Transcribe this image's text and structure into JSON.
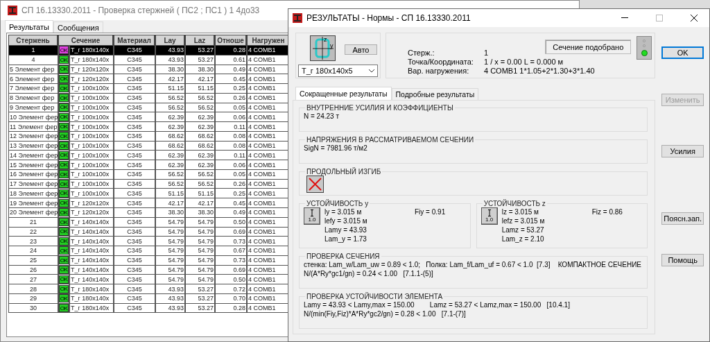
{
  "back_window": {
    "title": "СП 16.13330.2011 - Проверка стержней ( ПС2 ; ПС1 ) 1 4до33",
    "tabs": [
      {
        "label": "Результаты",
        "selected": true
      },
      {
        "label": "Сообщения",
        "selected": false
      }
    ],
    "table": {
      "columns": [
        "Стержень",
        "Сечение",
        "Материал",
        "Lay",
        "Laz",
        "Отноше",
        "Нагружен"
      ],
      "rows": [
        {
          "num": "1",
          "status": "OK",
          "section": "T_г 180x140x",
          "material": "C345",
          "lay": "43.93",
          "laz": "53.27",
          "ratio": "0.28",
          "load": "4 COMB1",
          "selected": true
        },
        {
          "num": "4",
          "status": "OK",
          "section": "T_г 180x140x",
          "material": "C345",
          "lay": "43.93",
          "laz": "53.27",
          "ratio": "0.61",
          "load": "4 COMB1",
          "selected": false
        },
        {
          "num": "5",
          "name": "Элемент фер",
          "status": "OK",
          "section": "T_г 120x120x",
          "material": "C345",
          "lay": "38.30",
          "laz": "38.30",
          "ratio": "0.49",
          "load": "4 COMB1",
          "selected": false
        },
        {
          "num": "6",
          "name": "Элемент фер",
          "status": "OK",
          "section": "T_г 120x120x",
          "material": "C345",
          "lay": "42.17",
          "laz": "42.17",
          "ratio": "0.45",
          "load": "4 COMB1",
          "selected": false
        },
        {
          "num": "7",
          "name": "Элемент фер",
          "status": "OK",
          "section": "T_г 100x100x",
          "material": "C345",
          "lay": "51.15",
          "laz": "51.15",
          "ratio": "0.25",
          "load": "4 COMB1",
          "selected": false
        },
        {
          "num": "8",
          "name": "Элемент фер",
          "status": "OK",
          "section": "T_г 100x100x",
          "material": "C345",
          "lay": "56.52",
          "laz": "56.52",
          "ratio": "0.26",
          "load": "4 COMB1",
          "selected": false
        },
        {
          "num": "9",
          "name": "Элемент фер",
          "status": "OK",
          "section": "T_г 100x100x",
          "material": "C345",
          "lay": "56.52",
          "laz": "56.52",
          "ratio": "0.05",
          "load": "4 COMB1",
          "selected": false
        },
        {
          "num": "10",
          "name": "Элемент фер",
          "status": "OK",
          "section": "T_г 100x100x",
          "material": "C345",
          "lay": "62.39",
          "laz": "62.39",
          "ratio": "0.06",
          "load": "4 COMB1",
          "selected": false
        },
        {
          "num": "11",
          "name": "Элемент фер",
          "status": "OK",
          "section": "T_г 100x100x",
          "material": "C345",
          "lay": "62.39",
          "laz": "62.39",
          "ratio": "0.11",
          "load": "4 COMB1",
          "selected": false
        },
        {
          "num": "12",
          "name": "Элемент фер",
          "status": "OK",
          "section": "T_г 100x100x",
          "material": "C345",
          "lay": "68.62",
          "laz": "68.62",
          "ratio": "0.08",
          "load": "4 COMB1",
          "selected": false
        },
        {
          "num": "13",
          "name": "Элемент фер",
          "status": "OK",
          "section": "T_г 100x100x",
          "material": "C345",
          "lay": "68.62",
          "laz": "68.62",
          "ratio": "0.08",
          "load": "4 COMB1",
          "selected": false
        },
        {
          "num": "14",
          "name": "Элемент фер",
          "status": "OK",
          "section": "T_г 100x100x",
          "material": "C345",
          "lay": "62.39",
          "laz": "62.39",
          "ratio": "0.11",
          "load": "4 COMB1",
          "selected": false
        },
        {
          "num": "15",
          "name": "Элемент фер",
          "status": "OK",
          "section": "T_г 100x100x",
          "material": "C345",
          "lay": "62.39",
          "laz": "62.39",
          "ratio": "0.06",
          "load": "4 COMB1",
          "selected": false
        },
        {
          "num": "16",
          "name": "Элемент фер",
          "status": "OK",
          "section": "T_г 100x100x",
          "material": "C345",
          "lay": "56.52",
          "laz": "56.52",
          "ratio": "0.05",
          "load": "4 COMB1",
          "selected": false
        },
        {
          "num": "17",
          "name": "Элемент фер",
          "status": "OK",
          "section": "T_г 100x100x",
          "material": "C345",
          "lay": "56.52",
          "laz": "56.52",
          "ratio": "0.26",
          "load": "4 COMB1",
          "selected": false
        },
        {
          "num": "18",
          "name": "Элемент фер",
          "status": "OK",
          "section": "T_г 100x100x",
          "material": "C345",
          "lay": "51.15",
          "laz": "51.15",
          "ratio": "0.25",
          "load": "4 COMB1",
          "selected": false
        },
        {
          "num": "19",
          "name": "Элемент фер",
          "status": "OK",
          "section": "T_г 120x120x",
          "material": "C345",
          "lay": "42.17",
          "laz": "42.17",
          "ratio": "0.45",
          "load": "4 COMB1",
          "selected": false
        },
        {
          "num": "20",
          "name": "Элемент фер",
          "status": "OK",
          "section": "T_г 120x120x",
          "material": "C345",
          "lay": "38.30",
          "laz": "38.30",
          "ratio": "0.49",
          "load": "4 COMB1",
          "selected": false
        },
        {
          "num": "21",
          "status": "OK",
          "section": "T_г 140x140x",
          "material": "C345",
          "lay": "54.79",
          "laz": "54.79",
          "ratio": "0.50",
          "load": "4 COMB1",
          "selected": false
        },
        {
          "num": "22",
          "status": "OK",
          "section": "T_г 140x140x",
          "material": "C345",
          "lay": "54.79",
          "laz": "54.79",
          "ratio": "0.69",
          "load": "4 COMB1",
          "selected": false
        },
        {
          "num": "23",
          "status": "OK",
          "section": "T_г 140x140x",
          "material": "C345",
          "lay": "54.79",
          "laz": "54.79",
          "ratio": "0.73",
          "load": "4 COMB1",
          "selected": false
        },
        {
          "num": "24",
          "status": "OK",
          "section": "T_г 140x140x",
          "material": "C345",
          "lay": "54.79",
          "laz": "54.79",
          "ratio": "0.67",
          "load": "4 COMB1",
          "selected": false
        },
        {
          "num": "25",
          "status": "OK",
          "section": "T_г 140x140x",
          "material": "C345",
          "lay": "54.79",
          "laz": "54.79",
          "ratio": "0.73",
          "load": "4 COMB1",
          "selected": false
        },
        {
          "num": "26",
          "status": "OK",
          "section": "T_г 140x140x",
          "material": "C345",
          "lay": "54.79",
          "laz": "54.79",
          "ratio": "0.69",
          "load": "4 COMB1",
          "selected": false
        },
        {
          "num": "27",
          "status": "OK",
          "section": "T_г 140x140x",
          "material": "C345",
          "lay": "54.79",
          "laz": "54.79",
          "ratio": "0.50",
          "load": "4 COMB1",
          "selected": false
        },
        {
          "num": "28",
          "status": "OK",
          "section": "T_г 180x140x",
          "material": "C345",
          "lay": "43.93",
          "laz": "53.27",
          "ratio": "0.72",
          "load": "4 COMB1",
          "selected": false
        },
        {
          "num": "29",
          "status": "OK",
          "section": "T_г 180x140x",
          "material": "C345",
          "lay": "43.93",
          "laz": "53.27",
          "ratio": "0.70",
          "load": "4 COMB1",
          "selected": false
        },
        {
          "num": "30",
          "status": "OK",
          "section": "T_г 180x140x",
          "material": "C345",
          "lay": "43.93",
          "laz": "53.27",
          "ratio": "0.28",
          "load": "4 COMB1",
          "selected": false
        }
      ]
    }
  },
  "window": {
    "title": "РЕЗУЛЬТАТЫ - Нормы - СП 16.13330.2011",
    "section": {
      "axes": [
        "z",
        "y"
      ],
      "auto_button": "Авто",
      "profile": "T_г 180x140x5"
    },
    "info": {
      "fields": [
        {
          "label": "Стерж.:",
          "value": "1"
        },
        {
          "label": "Точка/Координата:",
          "value": "1 / x = 0.00 L = 0.000 м"
        },
        {
          "label": "Вар. нагружения:",
          "value": "4 COMB1  1*1.05+2*1.30+3*1.40"
        }
      ],
      "status": "Сечение подобрано",
      "lights": [
        {
          "on": false
        },
        {
          "on": false
        },
        {
          "on": true
        }
      ]
    },
    "tabs": [
      {
        "label": "Сокращенные результаты",
        "selected": true
      },
      {
        "label": "Подробные результаты",
        "selected": false
      }
    ],
    "groups": [
      {
        "kind": "text",
        "title": "ВНУТРЕННИЕ УСИЛИЯ И КОЭФФИЦИЕНТЫ",
        "lines": [
          "N = 24.23 т"
        ]
      },
      {
        "kind": "text",
        "title": "НАПРЯЖЕНИЯ В РАССМАТРИВАЕМОМ СЕЧЕНИИ",
        "lines": [
          "SigN = 7981.96 т/м2"
        ]
      },
      {
        "kind": "cross",
        "title": "ПРОДОЛЬНЫЙ ИЗГИБ"
      },
      {
        "kind": "stability",
        "parts": [
          {
            "title": "УСТОЙЧИВОСТЬ y",
            "factor": "1.0",
            "lines": [
              "ly = 3.015 м",
              "lefy = 3.015 м",
              "Lamy = 43.93",
              "Lam_y = 1.73"
            ],
            "fi": "Fiy = 0.91"
          },
          {
            "title": "УСТОЙЧИВОСТЬ z",
            "factor": "1.0",
            "lines": [
              "lz = 3.015 м",
              "lefz = 3.015 м",
              "Lamz = 53.27",
              "Lam_z = 2.10"
            ],
            "fi": "Fiz = 0.86"
          }
        ]
      },
      {
        "kind": "text",
        "title": "ПРОВЕРКА СЕЧЕНИЯ",
        "lines": [
          "стенка: Lam_w/Lam_uw = 0.89 < 1.0;   Полка: Lam_f/Lam_uf = 0.67 < 1.0  [7.3]    КОМПАКТНОЕ СЕЧЕНИЕ",
          "N/(A*Ry*gc1/gn) = 0.24 < 1.00   [7.1.1-(5)]"
        ]
      },
      {
        "kind": "text",
        "title": "ПРОВЕРКА УСТОЙЧИВОСТИ ЭЛЕМЕНТА",
        "lines": [
          "Lamy = 43.93 < Lamy,max = 150.00        Lamz = 53.27 < Lamz,max = 150.00   [10.4.1]",
          "N/(min(Fiy,Fiz)*A*Ry*gc2/gn) = 0.28 < 1.00   [7.1-(7)]"
        ]
      }
    ],
    "buttons": [
      {
        "label": "OK",
        "disabled": false,
        "default": true
      },
      {
        "label": "Изменить",
        "disabled": true,
        "default": false
      },
      {
        "label": "Усилия",
        "disabled": false,
        "default": false
      },
      {
        "label": "Поясн.зап.",
        "disabled": false,
        "default": false
      },
      {
        "label": "Помощь",
        "disabled": false,
        "default": false
      }
    ]
  }
}
